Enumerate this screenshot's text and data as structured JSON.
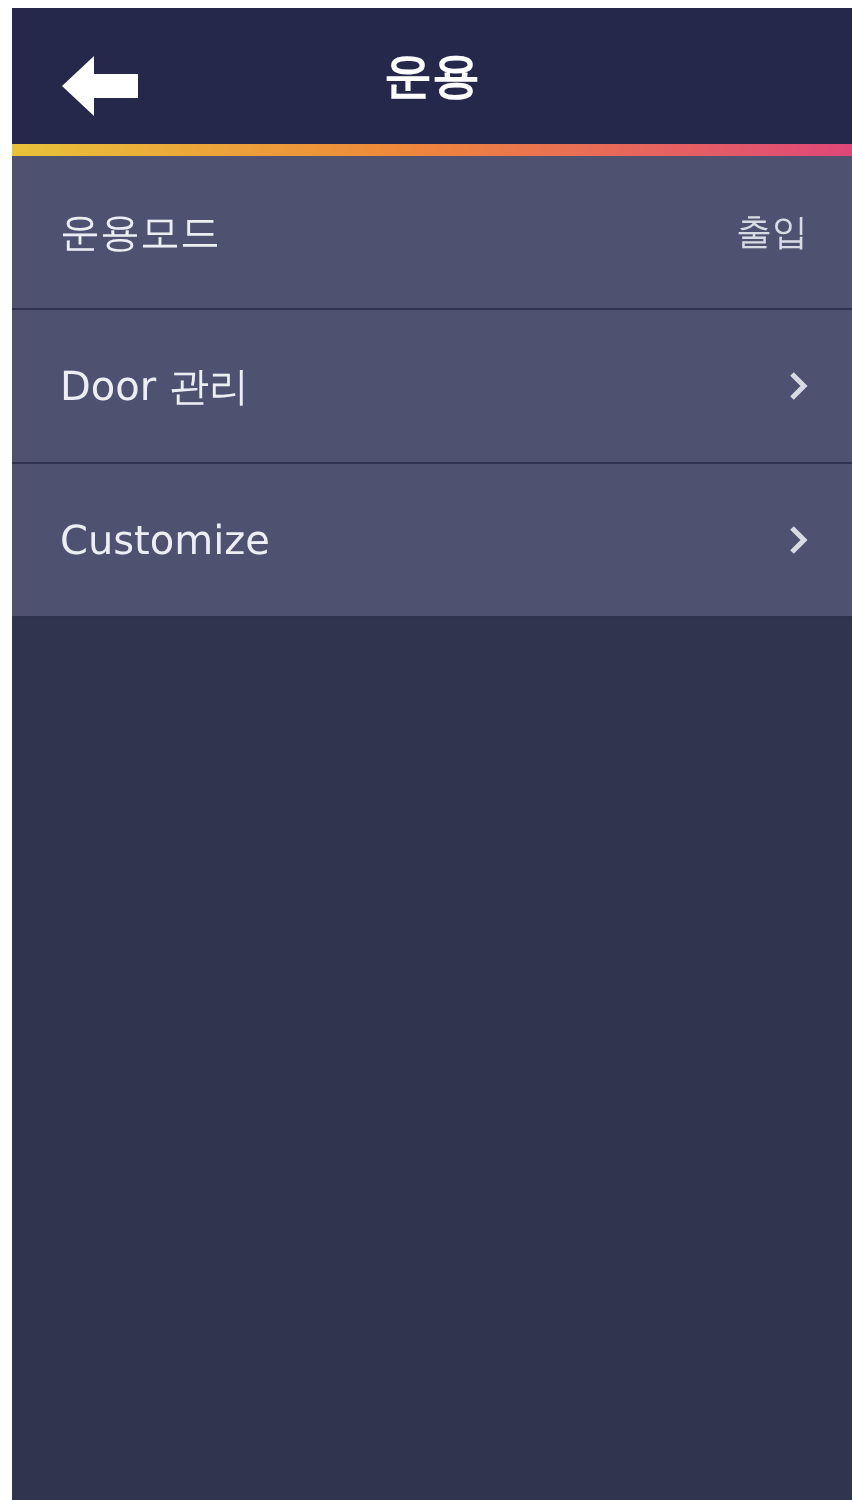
{
  "header": {
    "title": "운용"
  },
  "items": [
    {
      "label": "운용모드",
      "kind": "value",
      "value": "출입"
    },
    {
      "label": "Door 관리",
      "kind": "link"
    },
    {
      "label": "Customize",
      "kind": "link"
    }
  ]
}
